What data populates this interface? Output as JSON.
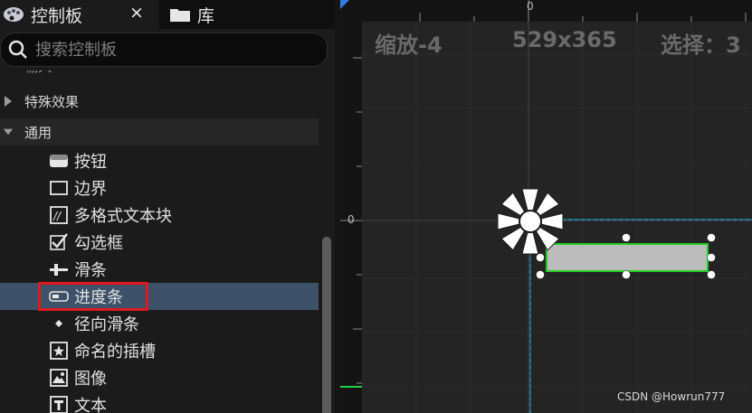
{
  "palette": {
    "tab_title": "控制板",
    "tab_close": "×",
    "library_tab": "库",
    "search_placeholder": "搜索控制板",
    "clipped_category": "输入",
    "categories": [
      {
        "label": "特殊效果",
        "expanded": false
      },
      {
        "label": "通用",
        "expanded": true
      }
    ],
    "items": [
      {
        "label": "按钮",
        "icon": "button-icon"
      },
      {
        "label": "边界",
        "icon": "border-icon"
      },
      {
        "label": "多格式文本块",
        "icon": "rich-text-icon"
      },
      {
        "label": "勾选框",
        "icon": "checkbox-icon"
      },
      {
        "label": "滑条",
        "icon": "slider-icon"
      },
      {
        "label": "进度条",
        "icon": "progress-bar-icon",
        "selected": true
      },
      {
        "label": "径向滑条",
        "icon": "radial-slider-icon"
      },
      {
        "label": "命名的插槽",
        "icon": "named-slot-icon"
      },
      {
        "label": "图像",
        "icon": "image-icon"
      },
      {
        "label": "文本",
        "icon": "text-icon"
      }
    ]
  },
  "designer": {
    "zoom_text": "缩放-4",
    "resolution_text": "529x365",
    "selection_text": "选择：3",
    "ruler_top_zero": "0",
    "ruler_left_zero": "0",
    "selection_outline_color": "#1ec8ff",
    "widget_outline_color": "#22d022",
    "progress_fill": 0
  },
  "watermark": "CSDN @Howrun777",
  "colors": {
    "accent": "#2f7de1",
    "selection_row": "#3d5168",
    "annotation_box": "#e0191e"
  }
}
